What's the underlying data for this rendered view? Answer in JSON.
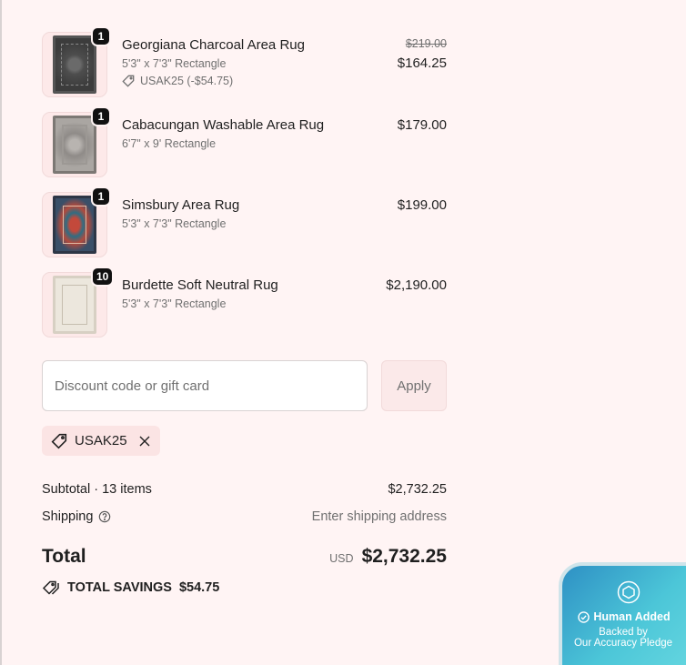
{
  "cart": {
    "items": [
      {
        "name": "Georgiana Charcoal Area Rug",
        "variant": "5'3\" x 7'3\" Rectangle",
        "discount": "USAK25 (-$54.75)",
        "original_price": "$219.00",
        "price": "$164.25",
        "quantity": "1"
      },
      {
        "name": "Cabacungan Washable Area Rug",
        "variant": "6'7\" x 9' Rectangle",
        "price": "$179.00",
        "quantity": "1"
      },
      {
        "name": "Simsbury Area Rug",
        "variant": "5'3\" x 7'3\" Rectangle",
        "price": "$199.00",
        "quantity": "1"
      },
      {
        "name": "Burdette Soft Neutral Rug",
        "variant": "5'3\" x 7'3\" Rectangle",
        "price": "$2,190.00",
        "quantity": "10"
      }
    ]
  },
  "discount": {
    "placeholder": "Discount code or gift card",
    "apply_label": "Apply",
    "applied_code": "USAK25"
  },
  "summary": {
    "subtotal_label": "Subtotal · 13 items",
    "subtotal_value": "$2,732.25",
    "shipping_label": "Shipping",
    "shipping_value": "Enter shipping address",
    "total_label": "Total",
    "currency": "USD",
    "total_value": "$2,732.25",
    "savings_label": "TOTAL SAVINGS",
    "savings_value": "$54.75"
  },
  "badge": {
    "title": "Human Added",
    "line1": "Backed by",
    "line2": "Our Accuracy Pledge"
  },
  "icons": {
    "tag": "tag-icon",
    "close": "close-icon",
    "help": "help-circle-icon",
    "savings": "double-tag-icon",
    "shield": "shield-icon",
    "check": "check-circle-icon"
  }
}
